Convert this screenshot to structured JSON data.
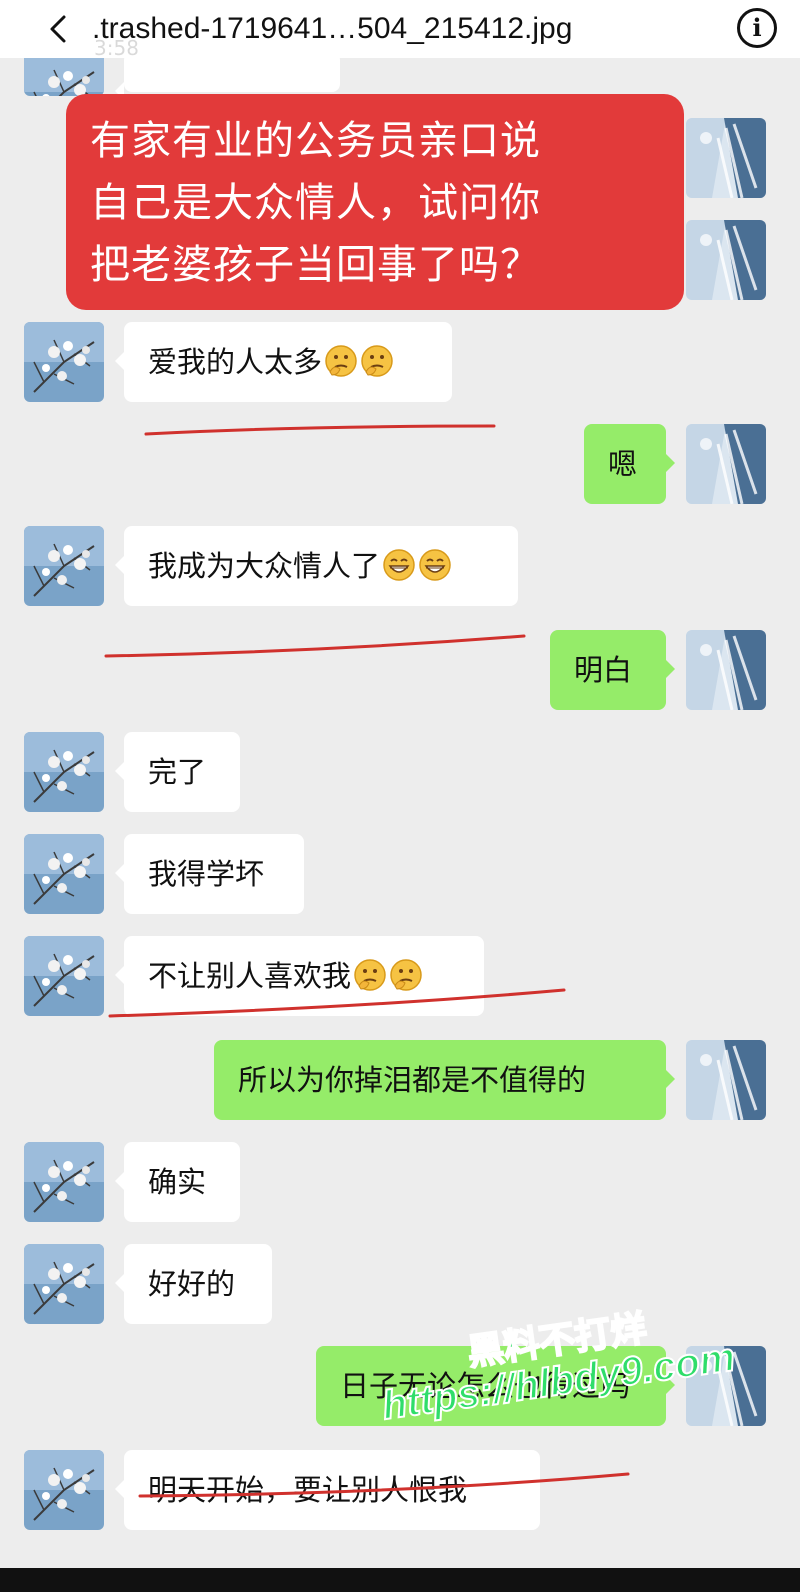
{
  "header": {
    "file_name": ".trashed-1719641…504_215412.jpg",
    "status_time_ghost": "3:58"
  },
  "banner": {
    "lines": [
      "有家有业的公务员亲口说",
      "自己是大众情人，试问你",
      "把老婆孩子当回事了吗？"
    ]
  },
  "messages": [
    {
      "side": "in",
      "text": "爱我的人太多",
      "emoji": [
        "thinking-face",
        "thinking-face"
      ]
    },
    {
      "side": "out",
      "text": "嗯"
    },
    {
      "side": "in",
      "text": "我成为大众情人了",
      "emoji": [
        "grin-face",
        "grin-face"
      ]
    },
    {
      "side": "out",
      "text": "明白"
    },
    {
      "side": "in",
      "text": "完了"
    },
    {
      "side": "in",
      "text": "我得学坏"
    },
    {
      "side": "in",
      "text": "不让别人喜欢我",
      "emoji": [
        "thinking-face",
        "thinking-face"
      ]
    },
    {
      "side": "out",
      "text": "所以为你掉泪都是不值得的"
    },
    {
      "side": "in",
      "text": "确实"
    },
    {
      "side": "in",
      "text": "好好的"
    },
    {
      "side": "out",
      "text": "日子无论怎么也得过吗"
    },
    {
      "side": "in",
      "text": "明天开始，要让别人恨我"
    }
  ],
  "watermark": {
    "line1": "黑料不打烊",
    "line2": "https://hlbdy9.com"
  },
  "colors": {
    "incoming_bubble": "#ffffff",
    "outgoing_bubble": "#95ec69",
    "banner": "#e23a3a",
    "annotation": "#d0312d",
    "watermark": "#2fdd6a"
  }
}
